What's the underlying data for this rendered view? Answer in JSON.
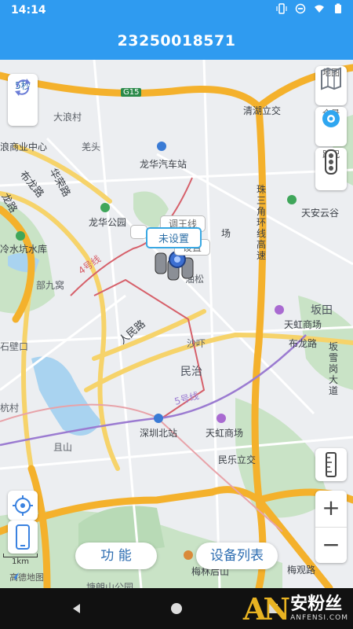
{
  "status": {
    "time": "14:14"
  },
  "header": {
    "title": "23250018571"
  },
  "controls": {
    "refresh_label": "5秒",
    "map_label": "地图",
    "panorama_label": "全景",
    "traffic_label": "路况",
    "scale_label": "1km",
    "zoom_in": "+",
    "zoom_out": "−"
  },
  "bubbles": {
    "main": "未设置",
    "ghost1": "调王线",
    "ghost2": "设置"
  },
  "buttons": {
    "function_label": "功 能",
    "device_list_label": "设备列表"
  },
  "map": {
    "labels": {
      "g15": "G15",
      "qinghu": "清湖立交",
      "dalang": "大浪村",
      "langshang": "浪商业中心",
      "qiantou": "羌头",
      "longhua_bus": "龙华汽车站",
      "longhua_park": "龙华公园",
      "buling_rd": "布龙路",
      "huarong_rd": "华荣路",
      "longlu": "龙路",
      "lengshui": "冷水坑水库",
      "buji": "部九窝",
      "line4": "4号线",
      "renmin_rd": "人民路",
      "shiyan": "石壁口",
      "shahang": "沙吓",
      "minzhi": "民治",
      "line5": "5号线",
      "shenzhen_north": "深圳北站",
      "tianhong1": "天虹商场",
      "tianhong2": "天虹商场",
      "minle": "民乐立交",
      "bantian": "坂田",
      "tianan": "天安云谷",
      "buling_rd2": "布龙路",
      "qiaoshan": "且山",
      "hangcun": "杭村",
      "meilin": "梅林后山",
      "meiguan": "梅观路",
      "tanglang": "塘朗山公园",
      "amap": "高德地图",
      "youlong": "油松",
      "changfang": "场"
    },
    "vertical": {
      "zhusanjiao": "珠三角环线高速",
      "bansuegang": "坂雪岗大道"
    }
  },
  "watermark": {
    "text": "安粉丝",
    "sub": "ANFENSI.COM",
    "logo": "AN"
  }
}
